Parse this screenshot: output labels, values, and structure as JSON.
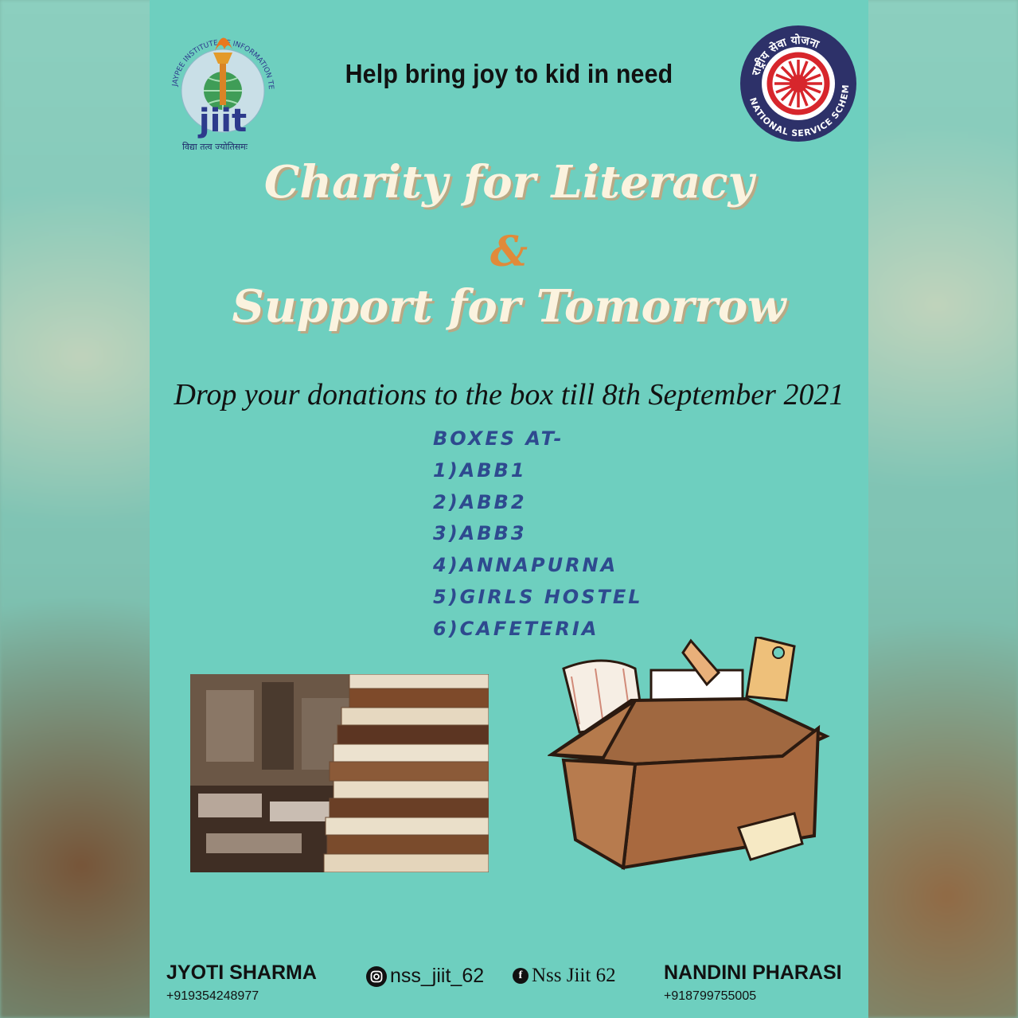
{
  "logos": {
    "left_arc_text": "JAYPEE INSTITUTE OF INFORMATION TECHNOLOGY",
    "left_wordmark": "jiit",
    "left_motto": "विद्या तत्व ज्योतिसमः",
    "right_top_text": "राष्ट्रीय सेवा योजना",
    "right_bottom_text": "NATIONAL SERVICE SCHEME"
  },
  "tagline": "Help bring joy to kid in need",
  "title_line1": "Charity for Literacy",
  "title_amp": "&",
  "title_line2": "Support for Tomorrow",
  "drop_text": "Drop your donations to the box till 8th September 2021",
  "boxes": {
    "heading": "BOXES AT-",
    "items": [
      "1)ABB1",
      "2)ABB2",
      "3)ABB3",
      "4)ANNAPURNA",
      "5)GIRLS HOSTEL",
      "6)CAFETERIA"
    ]
  },
  "footer": {
    "left_name": "JYOTI SHARMA",
    "left_phone": "+919354248977",
    "instagram": "nss_jiit_62",
    "facebook": "Nss Jiit 62",
    "right_name": "NANDINI PHARASI",
    "right_phone": "+918799755005"
  },
  "icons": [
    "instagram-icon",
    "facebook-icon",
    "torch-icon",
    "globe-icon",
    "wheel-icon"
  ],
  "colors": {
    "poster_bg": "#6ecfbf",
    "title_fill": "#fbf3df",
    "ampersand": "#e08a3a",
    "boxes_text": "#2e4a8f",
    "logo_blue": "#2d3a8c",
    "nss_red": "#d7262c"
  }
}
